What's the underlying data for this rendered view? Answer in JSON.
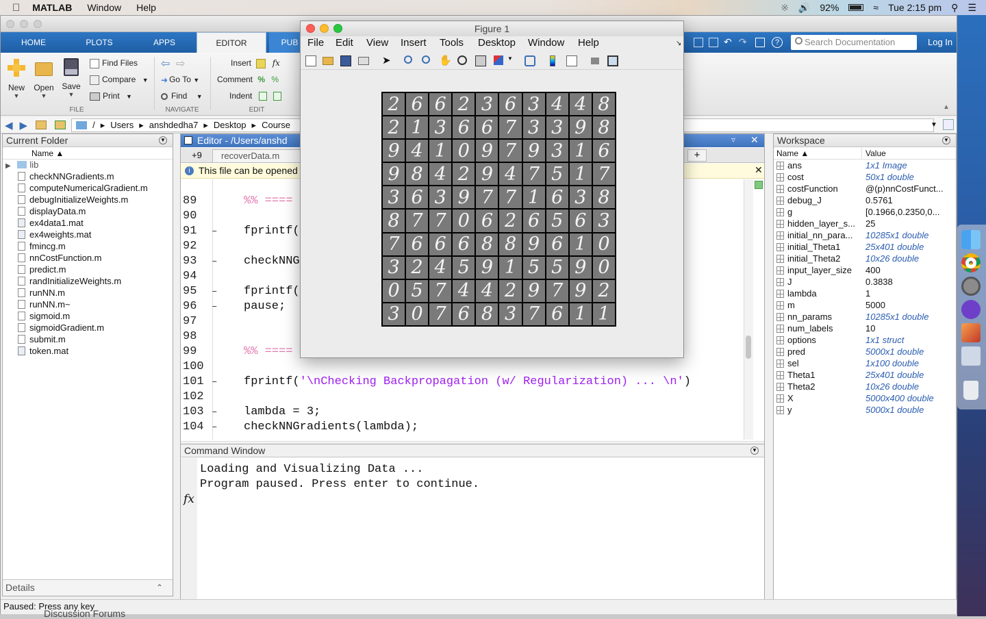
{
  "menubar": {
    "app": "MATLAB",
    "items": [
      "Window",
      "Help"
    ],
    "battery": "92%",
    "clock": "Tue 2:15 pm"
  },
  "tabs": [
    "HOME",
    "PLOTS",
    "APPS",
    "EDITOR",
    "PUB"
  ],
  "ribbon": {
    "new": "New",
    "open": "Open",
    "save": "Save",
    "find_files": "Find Files",
    "compare": "Compare",
    "print": "Print",
    "go_to": "Go To",
    "find": "Find",
    "insert": "Insert",
    "comment": "Comment",
    "indent": "Indent",
    "sections": {
      "file": "FILE",
      "navigate": "NAVIGATE",
      "edit": "EDIT"
    },
    "search_placeholder": "Search Documentation",
    "login": "Log In"
  },
  "address": [
    "/",
    "Users",
    "anshdedha7",
    "Desktop",
    "Course"
  ],
  "current_folder": {
    "title": "Current Folder",
    "col_name": "Name ▲",
    "folder": "lib",
    "files": [
      "checkNNGradients.m",
      "computeNumericalGradient.m",
      "debugInitializeWeights.m",
      "displayData.m",
      "ex4data1.mat",
      "ex4weights.mat",
      "fmincg.m",
      "nnCostFunction.m",
      "predict.m",
      "randInitializeWeights.m",
      "runNN.m",
      "runNN.m~",
      "sigmoid.m",
      "sigmoidGradient.m",
      "submit.m",
      "token.mat"
    ],
    "details": "Details"
  },
  "editor": {
    "title": "Editor - /Users/anshd",
    "tab_count": "+9",
    "tab": "recoverData.m",
    "notice": "This file can be opened",
    "lines": [
      {
        "n": "89",
        "dash": "",
        "code": "%% ====",
        "kind": "cm"
      },
      {
        "n": "90",
        "dash": "",
        "code": "",
        "kind": "plain"
      },
      {
        "n": "91",
        "dash": "–",
        "code": "fprintf(",
        "kind": "plain"
      },
      {
        "n": "92",
        "dash": "",
        "code": "",
        "kind": "plain"
      },
      {
        "n": "93",
        "dash": "–",
        "code": "checkNNG",
        "kind": "plain"
      },
      {
        "n": "94",
        "dash": "",
        "code": "",
        "kind": "plain"
      },
      {
        "n": "95",
        "dash": "–",
        "code": "fprintf(",
        "kind": "plain"
      },
      {
        "n": "96",
        "dash": "–",
        "code": "pause;",
        "kind": "plain"
      },
      {
        "n": "97",
        "dash": "",
        "code": "",
        "kind": "plain"
      },
      {
        "n": "98",
        "dash": "",
        "code": "",
        "kind": "plain"
      },
      {
        "n": "99",
        "dash": "",
        "code": "%% ====",
        "kind": "cm"
      },
      {
        "n": "100",
        "dash": "",
        "code": "",
        "kind": "plain"
      },
      {
        "n": "101",
        "dash": "–",
        "code": "fprintf(",
        "str": "'\\nChecking Backpropagation (w/ Regularization) ... \\n'",
        "tail": ")",
        "kind": "str"
      },
      {
        "n": "102",
        "dash": "",
        "code": "",
        "kind": "plain"
      },
      {
        "n": "103",
        "dash": "–",
        "code": "lambda = 3;",
        "kind": "plain"
      },
      {
        "n": "104",
        "dash": "–",
        "code": "checkNNGradients(lambda);",
        "kind": "plain"
      }
    ]
  },
  "command_window": {
    "title": "Command Window",
    "lines": [
      "Loading and Visualizing Data ...",
      "Program paused. Press enter to continue."
    ],
    "prompt": "fx"
  },
  "workspace": {
    "title": "Workspace",
    "col_name": "Name ▲",
    "col_value": "Value",
    "vars": [
      {
        "name": "ans",
        "value": "1x1 Image",
        "blue": true
      },
      {
        "name": "cost",
        "value": "50x1 double",
        "blue": true
      },
      {
        "name": "costFunction",
        "value": "@(p)nnCostFunct...",
        "blue": false
      },
      {
        "name": "debug_J",
        "value": "0.5761",
        "blue": false
      },
      {
        "name": "g",
        "value": "[0.1966,0.2350,0...",
        "blue": false
      },
      {
        "name": "hidden_layer_s...",
        "value": "25",
        "blue": false
      },
      {
        "name": "initial_nn_para...",
        "value": "10285x1 double",
        "blue": true
      },
      {
        "name": "initial_Theta1",
        "value": "25x401 double",
        "blue": true
      },
      {
        "name": "initial_Theta2",
        "value": "10x26 double",
        "blue": true
      },
      {
        "name": "input_layer_size",
        "value": "400",
        "blue": false
      },
      {
        "name": "J",
        "value": "0.3838",
        "blue": false
      },
      {
        "name": "lambda",
        "value": "1",
        "blue": false
      },
      {
        "name": "m",
        "value": "5000",
        "blue": false
      },
      {
        "name": "nn_params",
        "value": "10285x1 double",
        "blue": true
      },
      {
        "name": "num_labels",
        "value": "10",
        "blue": false
      },
      {
        "name": "options",
        "value": "1x1 struct",
        "blue": true
      },
      {
        "name": "pred",
        "value": "5000x1 double",
        "blue": true
      },
      {
        "name": "sel",
        "value": "1x100 double",
        "blue": true
      },
      {
        "name": "Theta1",
        "value": "25x401 double",
        "blue": true
      },
      {
        "name": "Theta2",
        "value": "10x26 double",
        "blue": true
      },
      {
        "name": "X",
        "value": "5000x400 double",
        "blue": true
      },
      {
        "name": "y",
        "value": "5000x1 double",
        "blue": true
      }
    ]
  },
  "status": "Paused: Press any key",
  "behind_text": "Discussion Forums",
  "figure": {
    "title": "Figure 1",
    "menu": [
      "File",
      "Edit",
      "View",
      "Insert",
      "Tools",
      "Desktop",
      "Window",
      "Help"
    ],
    "digits": [
      "2",
      "6",
      "6",
      "2",
      "3",
      "6",
      "3",
      "4",
      "4",
      "8",
      "2",
      "1",
      "3",
      "6",
      "6",
      "7",
      "3",
      "3",
      "9",
      "8",
      "9",
      "4",
      "1",
      "0",
      "9",
      "7",
      "9",
      "3",
      "1",
      "6",
      "9",
      "8",
      "4",
      "2",
      "9",
      "4",
      "7",
      "5",
      "1",
      "7",
      "3",
      "6",
      "3",
      "9",
      "7",
      "7",
      "1",
      "6",
      "3",
      "8",
      "8",
      "7",
      "7",
      "0",
      "6",
      "2",
      "6",
      "5",
      "6",
      "3",
      "7",
      "6",
      "6",
      "6",
      "8",
      "8",
      "9",
      "6",
      "1",
      "0",
      "3",
      "2",
      "4",
      "5",
      "9",
      "1",
      "5",
      "5",
      "9",
      "0",
      "0",
      "5",
      "7",
      "4",
      "4",
      "2",
      "9",
      "7",
      "9",
      "2",
      "3",
      "0",
      "7",
      "6",
      "8",
      "3",
      "7",
      "6",
      "1",
      "1"
    ]
  }
}
